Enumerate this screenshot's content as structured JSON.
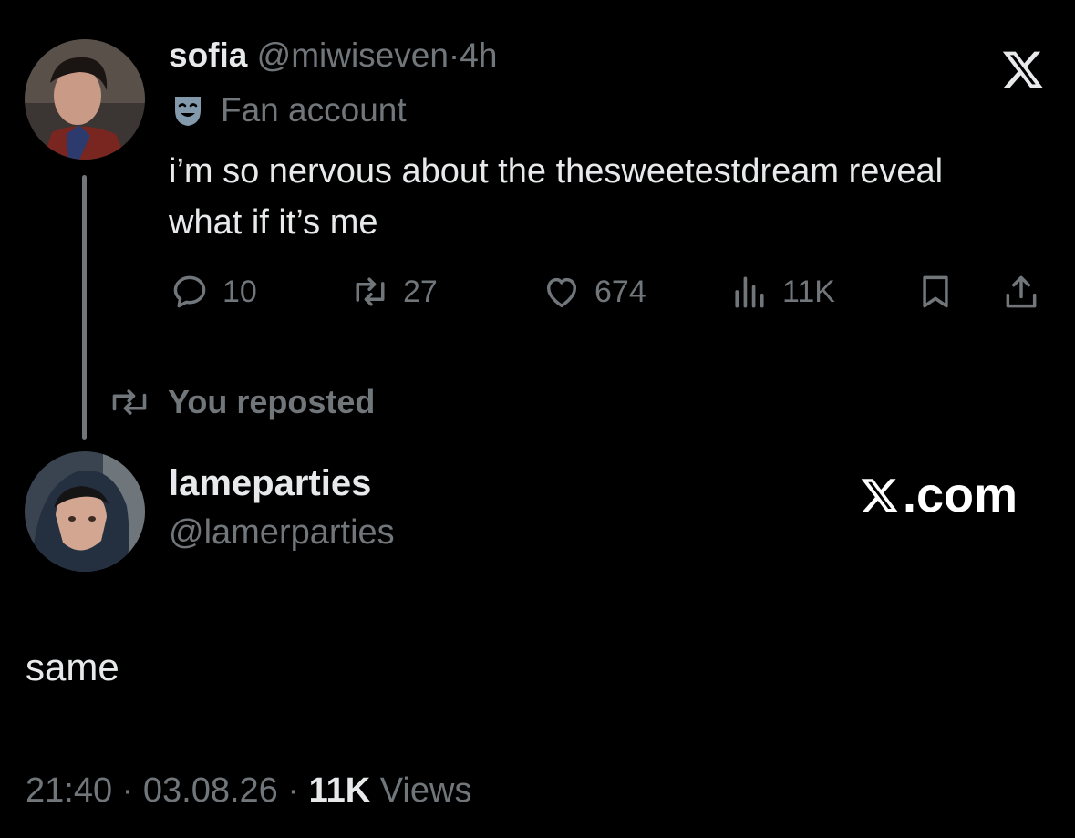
{
  "quoted_tweet": {
    "display_name": "sofia",
    "handle": "@miwiseven",
    "separator": "·",
    "time": "4h",
    "label": "Fan account",
    "text": "i’m so nervous about the thesweetestdream reveal what if it’s me",
    "stats": {
      "replies": "10",
      "reposts": "27",
      "likes": "674",
      "views": "11K"
    }
  },
  "repost_banner": {
    "text": "You reposted"
  },
  "main_tweet": {
    "display_name": "lameparties",
    "handle": "@lamerparties",
    "text": "same",
    "time": "21:40",
    "separator": "·",
    "date": "03.08.26",
    "views_count": "11K",
    "views_label": "Views"
  },
  "watermark": {
    "text": ".com"
  },
  "icons": {
    "brand": "x-logo-icon",
    "label": "theater-mask-icon",
    "reply": "comment-bubble-icon",
    "repost": "repost-arrows-icon",
    "like": "heart-icon",
    "views": "bar-chart-icon",
    "bookmark": "bookmark-icon",
    "share": "share-upload-icon"
  },
  "colors": {
    "background": "#000000",
    "primary_text": "#e7e9ea",
    "secondary_text": "#71767b",
    "label_icon": "#829aab"
  }
}
